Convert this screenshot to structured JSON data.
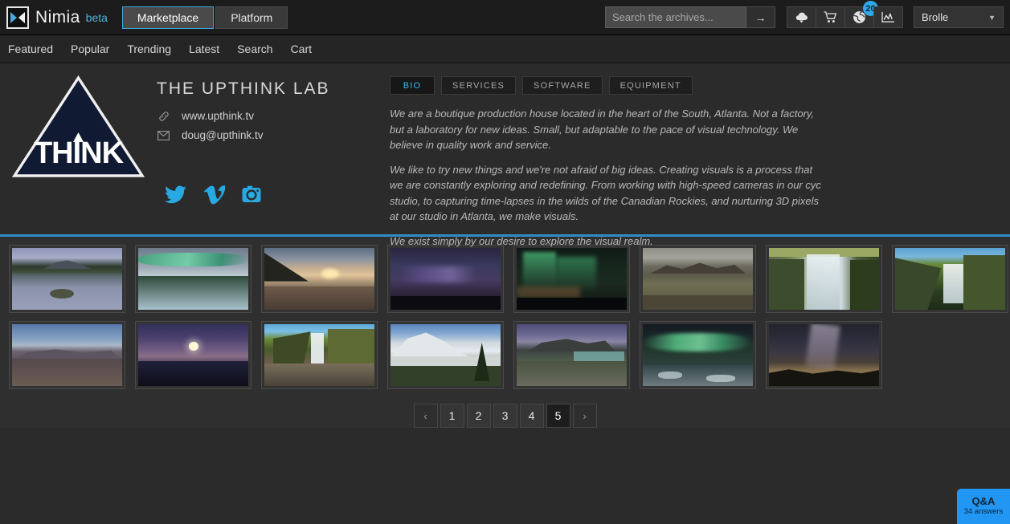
{
  "header": {
    "brand_name": "Nimia",
    "brand_beta": "beta",
    "logo_icon": "nimia-play-mark-icon",
    "pills": [
      {
        "label": "Marketplace",
        "active": true
      },
      {
        "label": "Platform",
        "active": false
      }
    ],
    "search": {
      "placeholder": "Search the archives...",
      "value": "",
      "submit_label": "→",
      "icon": "arrow-right-icon"
    },
    "icon_buttons": [
      {
        "name": "cloud-upload-icon",
        "badge": ""
      },
      {
        "name": "shopping-cart-icon",
        "badge": ""
      },
      {
        "name": "globe-icon",
        "badge": "20"
      },
      {
        "name": "analytics-chart-icon",
        "badge": ""
      }
    ],
    "user": {
      "name": "Brolle",
      "caret_icon": "chevron-down-icon"
    }
  },
  "subnav": {
    "items": [
      {
        "label": "Featured"
      },
      {
        "label": "Popular"
      },
      {
        "label": "Trending"
      },
      {
        "label": "Latest"
      },
      {
        "label": "Search"
      },
      {
        "label": "Cart"
      }
    ]
  },
  "profile": {
    "logo_text": "THINK",
    "org_title": "THE UPTHINK LAB",
    "website": {
      "icon": "link-icon",
      "text": "www.upthink.tv"
    },
    "email": {
      "icon": "envelope-icon",
      "text": "doug@upthink.tv"
    },
    "socials": [
      {
        "name": "twitter-icon"
      },
      {
        "name": "vimeo-icon"
      },
      {
        "name": "instagram-icon"
      }
    ],
    "tabs": [
      {
        "label": "BIO",
        "active": true
      },
      {
        "label": "SERVICES",
        "active": false
      },
      {
        "label": "SOFTWARE",
        "active": false
      },
      {
        "label": "EQUIPMENT",
        "active": false
      }
    ],
    "bio_paragraphs": [
      "We are a boutique production house located in the heart of the South, Atlanta. Not a factory, but a laboratory for new ideas. Small, but adaptable to the pace of visual technology. We believe in quality work and service.",
      "We like to try new things and we're not afraid of big ideas. Creating visuals is a process that we are constantly exploring and redefining. From working with high-speed cameras in our cyc studio, to capturing time-lapses in the wilds of the Canadian Rockies, and nurturing 3D pixels at our studio in Atlanta, we make visuals.",
      "We exist simply by our desire to explore the visual realm."
    ]
  },
  "gallery": {
    "thumbnails": [
      {
        "alt": "mountain-lake-reflection"
      },
      {
        "alt": "aurora-over-snowy-forest"
      },
      {
        "alt": "coastal-sunset-rocks"
      },
      {
        "alt": "purple-aurora-night-sky"
      },
      {
        "alt": "green-aurora-dark-sky"
      },
      {
        "alt": "highland-valley-overcast"
      },
      {
        "alt": "tall-waterfall-green-cliff"
      },
      {
        "alt": "waterfall-mossy-canyon"
      },
      {
        "alt": "blue-ridge-hills-dusk"
      },
      {
        "alt": "moonrise-over-dark-ridge"
      },
      {
        "alt": "waterfall-rocky-stream"
      },
      {
        "alt": "snowy-peak-glacial-lake"
      },
      {
        "alt": "alpine-lake-panorama"
      },
      {
        "alt": "aurora-over-icy-lagoon"
      },
      {
        "alt": "milky-way-desert-night"
      }
    ]
  },
  "pagination": {
    "prev_label": "‹",
    "next_label": "›",
    "pages": [
      {
        "label": "1",
        "active": false
      },
      {
        "label": "2",
        "active": false
      },
      {
        "label": "3",
        "active": false
      },
      {
        "label": "4",
        "active": false
      },
      {
        "label": "5",
        "active": true
      }
    ]
  },
  "qa_widget": {
    "title": "Q&A",
    "subtitle": "34 answers"
  },
  "colors": {
    "accent": "#2b8fc4",
    "social": "#29a9e1",
    "badge": "#2fa8e8",
    "qa": "#2196f3"
  }
}
